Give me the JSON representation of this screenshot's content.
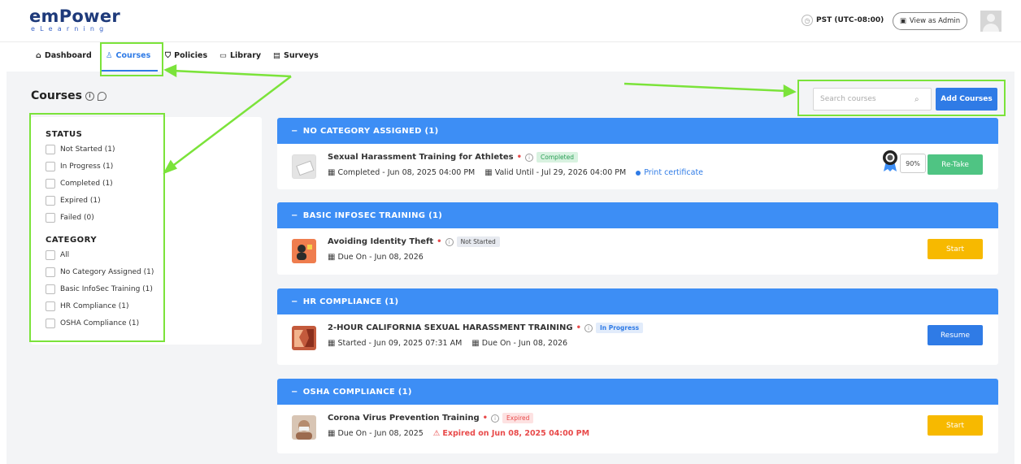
{
  "header": {
    "logo_main": "emPower",
    "logo_sub": "eLearning",
    "timezone": "PST (UTC-08:00)",
    "view_as_admin": "View as Admin"
  },
  "nav": {
    "items": [
      {
        "label": "Dashboard",
        "icon": "home-icon"
      },
      {
        "label": "Courses",
        "icon": "ribbon-icon",
        "active": true
      },
      {
        "label": "Policies",
        "icon": "shield-icon"
      },
      {
        "label": "Library",
        "icon": "folder-icon"
      },
      {
        "label": "Surveys",
        "icon": "document-icon"
      }
    ]
  },
  "page": {
    "title": "Courses"
  },
  "search": {
    "placeholder": "Search courses"
  },
  "add_button": "Add Courses",
  "filters": {
    "status_heading": "STATUS",
    "status": [
      "Not Started (1)",
      "In Progress (1)",
      "Completed (1)",
      "Expired (1)",
      "Failed (0)"
    ],
    "category_heading": "CATEGORY",
    "category": [
      "All",
      "No Category Assigned (1)",
      "Basic InfoSec Training (1)",
      "HR Compliance (1)",
      "OSHA Compliance (1)"
    ]
  },
  "categories": [
    {
      "name": "NO CATEGORY ASSIGNED (1)",
      "course": {
        "title": "Sexual Harassment Training for Athletes",
        "status": "Completed",
        "meta1": "Completed - Jun 08, 2025 04:00 PM",
        "meta2": "Valid Until - Jul 29, 2026 04:00 PM",
        "print": "Print certificate",
        "score": "90%",
        "action": "Re-Take"
      }
    },
    {
      "name": "BASIC INFOSEC TRAINING (1)",
      "course": {
        "title": "Avoiding Identity Theft",
        "status": "Not Started",
        "meta1": "Due On - Jun 08, 2026",
        "action": "Start"
      }
    },
    {
      "name": "HR COMPLIANCE (1)",
      "course": {
        "title": "2-HOUR CALIFORNIA SEXUAL HARASSMENT TRAINING",
        "status": "In Progress",
        "meta1": "Started - Jun 09, 2025 07:31 AM",
        "meta2": "Due On - Jun 08, 2026",
        "action": "Resume"
      }
    },
    {
      "name": "OSHA COMPLIANCE (1)",
      "course": {
        "title": "Corona Virus Prevention Training",
        "status": "Expired",
        "meta1": "Due On - Jun 08, 2025",
        "expired_note": "Expired on Jun 08, 2025 04:00 PM",
        "action": "Start"
      }
    }
  ],
  "colors": {
    "primary": "#2f7be6",
    "category_bar": "#3d8ef5",
    "retake": "#4fc483",
    "start": "#f7b900",
    "annotation": "#7be33a"
  }
}
